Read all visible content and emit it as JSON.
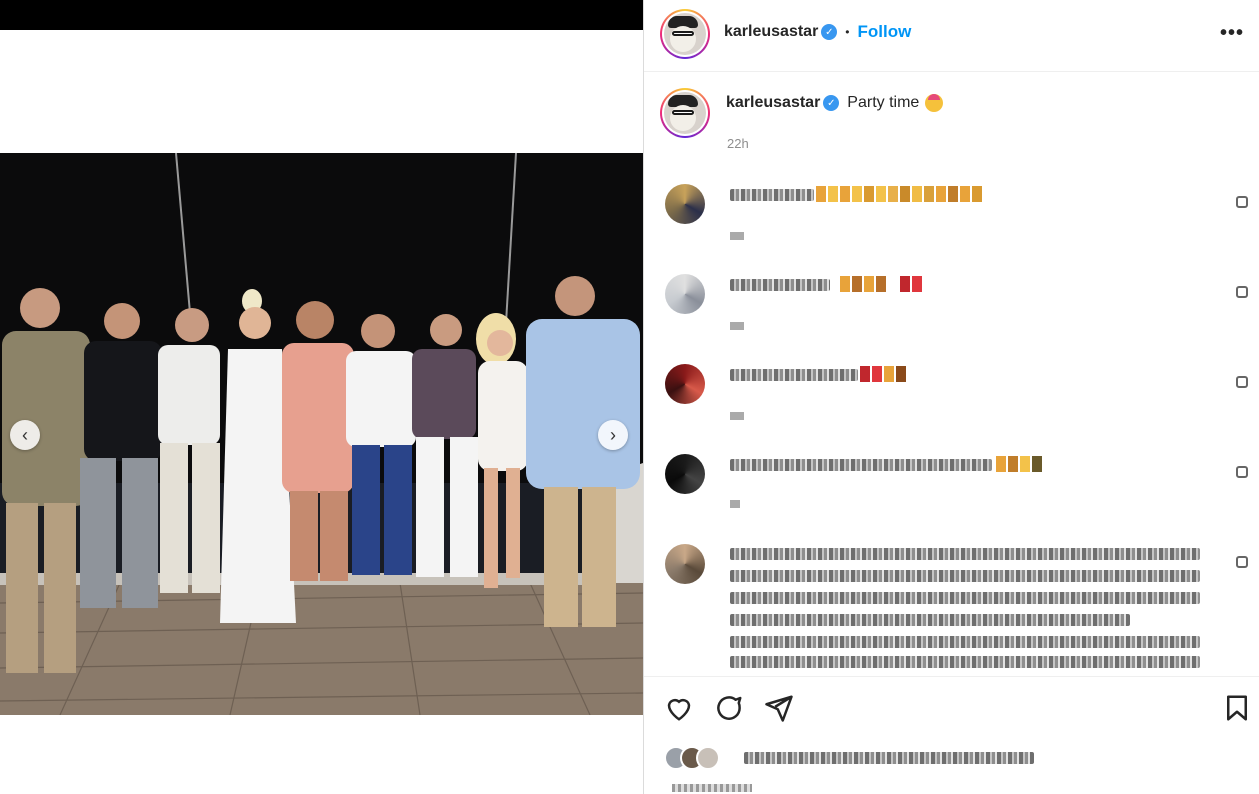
{
  "post": {
    "username": "karleusastar",
    "verified": true,
    "follow_label": "Follow",
    "more_label": "•••",
    "caption": "Party time",
    "time_ago": "22h"
  },
  "carousel": {
    "prev_icon": "chevron-left-icon",
    "next_icon": "chevron-right-icon",
    "prev_glyph": "‹",
    "next_glyph": "›"
  },
  "comments": [
    {
      "id": "c1"
    },
    {
      "id": "c2"
    },
    {
      "id": "c3"
    },
    {
      "id": "c4"
    },
    {
      "id": "c5"
    }
  ],
  "actions": {
    "icons": [
      "heart-icon",
      "comment-icon",
      "share-icon",
      "bookmark-icon"
    ]
  },
  "colors": {
    "accent": "#0095f6",
    "verified": "#3897f0",
    "muted": "#8e8e8e"
  }
}
